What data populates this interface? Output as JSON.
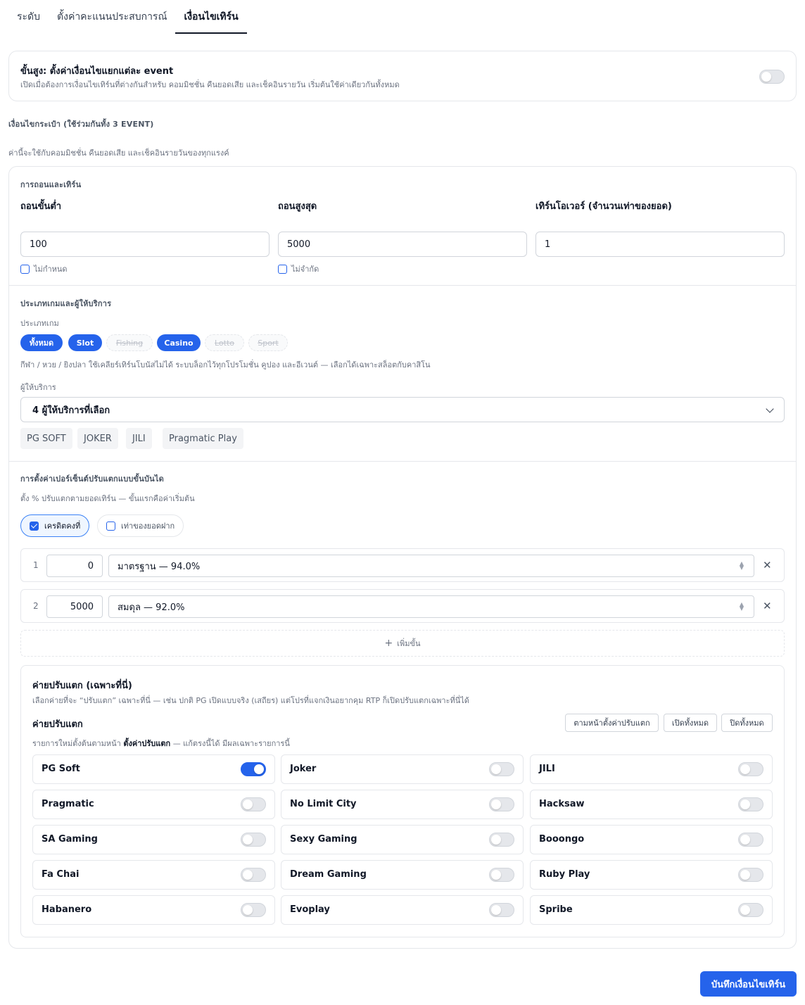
{
  "tabs": [
    "ระดับ",
    "ตั้งค่าคะแนนประสบการณ์",
    "เงื่อนไขเทิร์น"
  ],
  "advanced": {
    "title": "ขั้นสูง: ตั้งค่าเงื่อนไขแยกแต่ละ event",
    "desc": "เปิดเมื่อต้องการเงื่อนไขเทิร์นที่ต่างกันสำหรับ คอมมิชชั่น คืนยอดเสีย และเช็คอินรายวัน เริ่มต้นใช้ค่าเดียวกันทั้งหมด",
    "enabled": false
  },
  "wallet": {
    "heading": "เงื่อนไขกระเป๋า (ใช้ร่วมกันทั้ง 3 EVENT)",
    "desc": "ค่านี้จะใช้กับคอมมิชชั่น คืนยอดเสีย และเช็คอินรายวันของทุกแรงค์"
  },
  "withdraw": {
    "heading": "การถอนและเทิร์น",
    "min_label": "ถอนขั้นต่ำ",
    "min_value": "100",
    "min_check": "ไม่กำหนด",
    "max_label": "ถอนสูงสุด",
    "max_value": "5000",
    "max_check": "ไม่จำกัด",
    "turnover_label": "เทิร์นโอเวอร์ (จำนวนเท่าของยอด)",
    "turnover_value": "1"
  },
  "games": {
    "heading": "ประเภทเกมและผู้ให้บริการ",
    "type_label": "ประเภทเกม",
    "chips": [
      {
        "label": "ทั้งหมด",
        "state": "selected"
      },
      {
        "label": "Slot",
        "state": "selected"
      },
      {
        "label": "Fishing",
        "state": "disabled"
      },
      {
        "label": "Casino",
        "state": "selected"
      },
      {
        "label": "Lotto",
        "state": "disabled"
      },
      {
        "label": "Sport",
        "state": "disabled"
      }
    ],
    "note": "กีฬา / หวย / ยิงปลา ใช้เคลียร์เทิร์นโบนัสไม่ได้ ระบบล็อกไว้ทุกโปรโมชั่น คูปอง และอีเวนต์ — เลือกได้เฉพาะสล็อตกับคาสิโน",
    "provider_label": "ผู้ให้บริการ",
    "provider_select": "4 ผู้ให้บริการที่เลือก",
    "provider_tags": [
      "PG SOFT",
      "JOKER",
      "JILI",
      "Pragmatic Play"
    ]
  },
  "tiers": {
    "heading": "การตั้งค่าเปอร์เซ็นต์ปรับแตกแบบขั้นบันได",
    "desc": "ตั้ง % ปรับแตกตามยอดเทิร์น — ขั้นแรกคือค่าเริ่มต้น",
    "modes": [
      {
        "label": "เครดิตคงที่",
        "checked": true
      },
      {
        "label": "เท่าของยอดฝาก",
        "checked": false
      }
    ],
    "steps": [
      {
        "num": "1",
        "amount": "0",
        "option": "มาตรฐาน — 94.0%"
      },
      {
        "num": "2",
        "amount": "5000",
        "option": "สมดุล — 92.0%"
      }
    ],
    "add_label": "เพิ่มขั้น"
  },
  "camps": {
    "title": "ค่ายปรับแตก (เฉพาะที่นี่)",
    "desc": "เลือกค่ายที่จะ “ปรับแตก” เฉพาะที่นี่ — เช่น ปกติ PG เปิดแบบจริง (เสถียร) แต่โปรที่แจกเงินอยากคุม RTP ก็เปิดปรับแตกเฉพาะที่นี่ได้",
    "sub_title": "ค่ายปรับแตก",
    "btn_follow": "ตามหน้าตั้งค่าปรับแตก",
    "btn_open_all": "เปิดทั้งหมด",
    "btn_close_all": "ปิดทั้งหมด",
    "note_prefix": "รายการใหม่ตั้งต้นตามหน้า",
    "note_bold": "ตั้งค่าปรับแตก",
    "note_suffix": "— แก้ตรงนี้ได้ มีผลเฉพาะรายการนี้",
    "providers": [
      {
        "name": "PG Soft",
        "on": true
      },
      {
        "name": "Joker",
        "on": false
      },
      {
        "name": "JILI",
        "on": false
      },
      {
        "name": "Pragmatic",
        "on": false
      },
      {
        "name": "No Limit City",
        "on": false
      },
      {
        "name": "Hacksaw",
        "on": false
      },
      {
        "name": "SA Gaming",
        "on": false
      },
      {
        "name": "Sexy Gaming",
        "on": false
      },
      {
        "name": "Booongo",
        "on": false
      },
      {
        "name": "Fa Chai",
        "on": false
      },
      {
        "name": "Dream Gaming",
        "on": false
      },
      {
        "name": "Ruby Play",
        "on": false
      },
      {
        "name": "Habanero",
        "on": false
      },
      {
        "name": "Evoplay",
        "on": false
      },
      {
        "name": "Spribe",
        "on": false
      }
    ]
  },
  "save_label": "บันทึกเงื่อนไขเทิร์น"
}
